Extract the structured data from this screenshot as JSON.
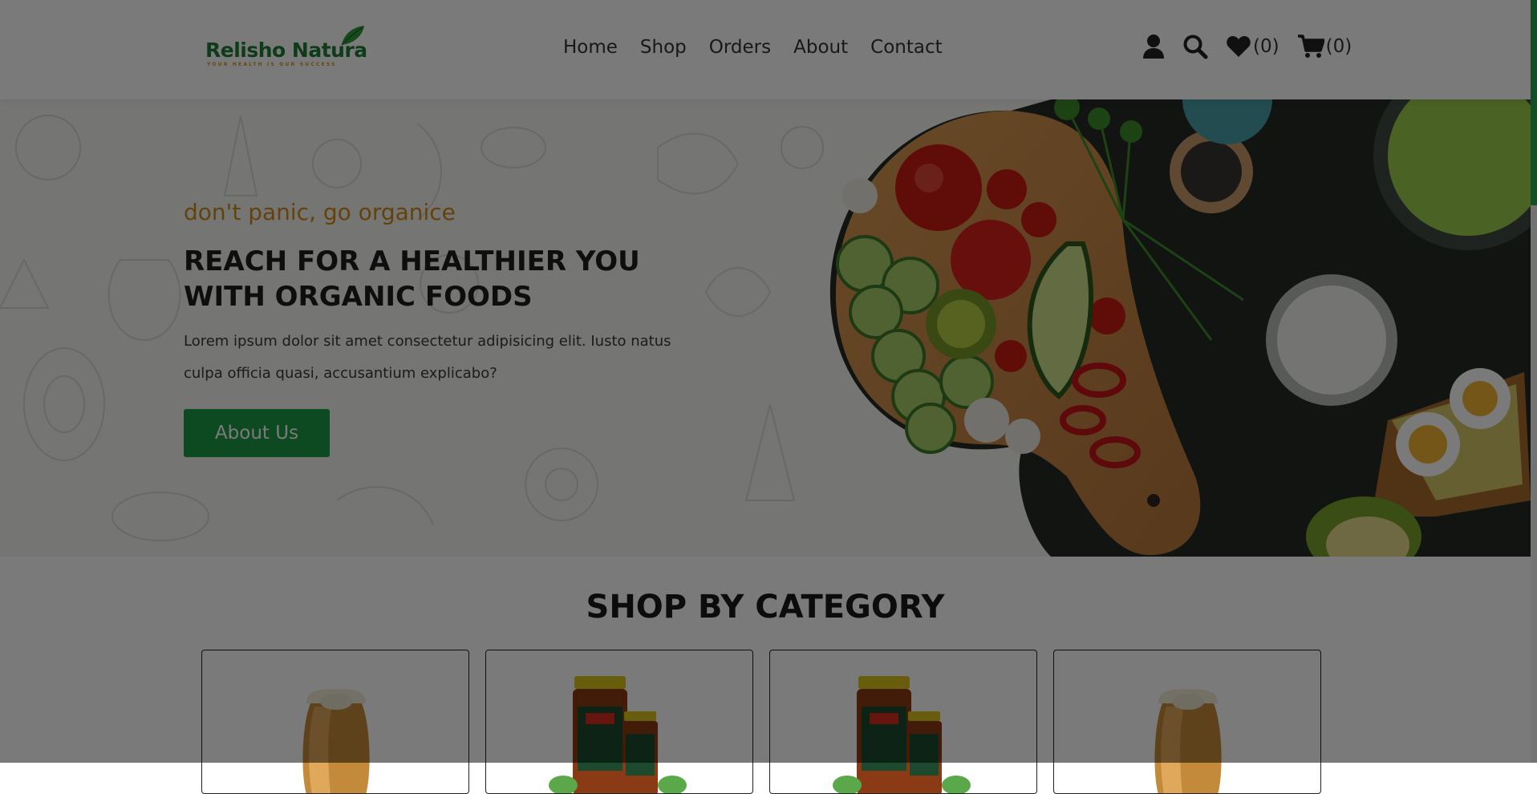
{
  "brand": {
    "name": "Relisho Natura",
    "tagline": "YOUR HEALTH IS OUR SUCCESS",
    "primary_color": "#1c9b45",
    "accent_color": "#cf8a1a"
  },
  "nav": {
    "items": [
      {
        "label": "Home"
      },
      {
        "label": "Shop"
      },
      {
        "label": "Orders"
      },
      {
        "label": "About"
      },
      {
        "label": "Contact"
      }
    ]
  },
  "header_icons": {
    "user_icon": "user-icon",
    "search_icon": "search-icon",
    "wishlist_icon": "heart-icon",
    "wishlist_count": "(0)",
    "cart_icon": "cart-icon",
    "cart_count": "(0)"
  },
  "hero": {
    "tagline": "don't panic, go organice",
    "headline_line1": "REACH FOR A HEALTHIER YOU",
    "headline_line2": "WITH ORGANIC FOODS",
    "description": "Lorem ipsum dolor sit amet consectetur adipisicing elit. Iusto natus culpa officia quasi, accusantium explicabo?",
    "button_label": "About Us"
  },
  "categories": {
    "title": "SHOP BY CATEGORY",
    "cards": [
      {
        "image": "honey-jar-image"
      },
      {
        "image": "pickle-jars-image"
      },
      {
        "image": "pickle-jars-image"
      },
      {
        "image": "honey-jar-image"
      }
    ]
  },
  "modal_overlay": {
    "visible": true
  }
}
